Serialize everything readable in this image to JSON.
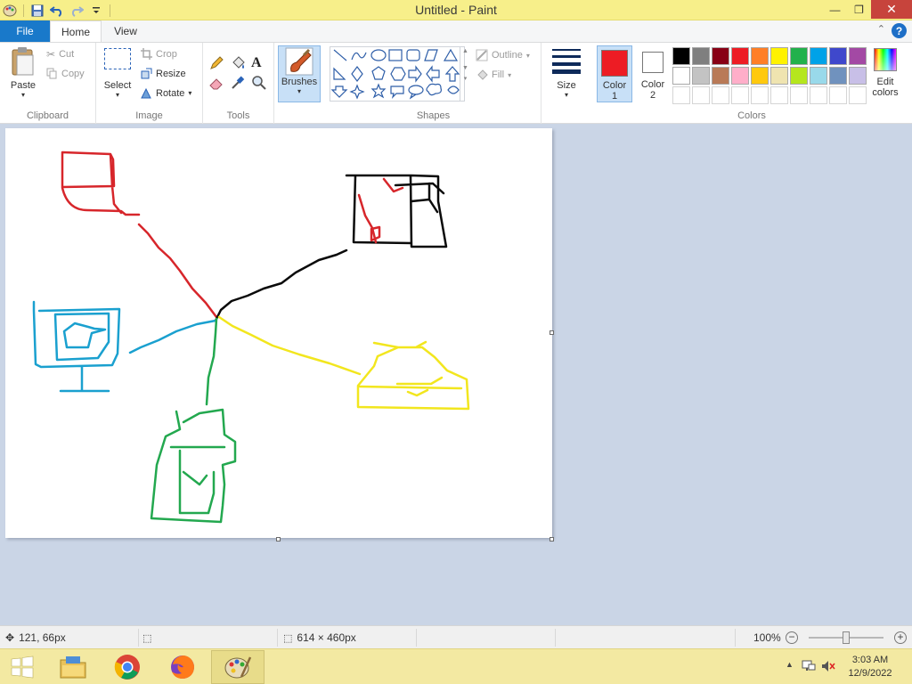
{
  "window": {
    "title": "Untitled - Paint"
  },
  "tabs": {
    "file": "File",
    "home": "Home",
    "view": "View"
  },
  "clipboard": {
    "paste": "Paste",
    "cut": "Cut",
    "copy": "Copy",
    "group": "Clipboard"
  },
  "image": {
    "select": "Select",
    "crop": "Crop",
    "resize": "Resize",
    "rotate": "Rotate",
    "group": "Image"
  },
  "tools": {
    "group": "Tools"
  },
  "brushes": {
    "label": "Brushes"
  },
  "shapes": {
    "outline": "Outline",
    "fill": "Fill",
    "group": "Shapes"
  },
  "size": {
    "label": "Size"
  },
  "colors": {
    "color1_line1": "Color",
    "color1_line2": "1",
    "color2_line1": "Color",
    "color2_line2": "2",
    "edit_line1": "Edit",
    "edit_line2": "colors",
    "group": "Colors",
    "color1_value": "#ed1c24",
    "color2_value": "#ffffff",
    "palette": [
      "#000000",
      "#7f7f7f",
      "#880015",
      "#ed1c24",
      "#ff7f27",
      "#fff200",
      "#22b14c",
      "#00a2e8",
      "#3f48cc",
      "#a349a4",
      "#ffffff",
      "#c3c3c3",
      "#b97a57",
      "#ffaec9",
      "#ffc90e",
      "#efe4b0",
      "#b5e61d",
      "#99d9ea",
      "#7092be",
      "#c8bfe7"
    ],
    "custom_empty_slots": 10
  },
  "status": {
    "cursor_pos": "121, 66px",
    "canvas_size": "614 × 460px",
    "zoom": "100%"
  },
  "taskbar": {
    "apps": [
      "file-explorer",
      "chrome",
      "firefox",
      "paint"
    ],
    "time": "3:03 AM",
    "date": "12/9/2022"
  },
  "drawing": {
    "stroke_colors": {
      "red": "#d7262b",
      "black": "#0a0a0a",
      "blue": "#1aa0cf",
      "yellow": "#f2e61e",
      "green": "#23a84f"
    }
  }
}
